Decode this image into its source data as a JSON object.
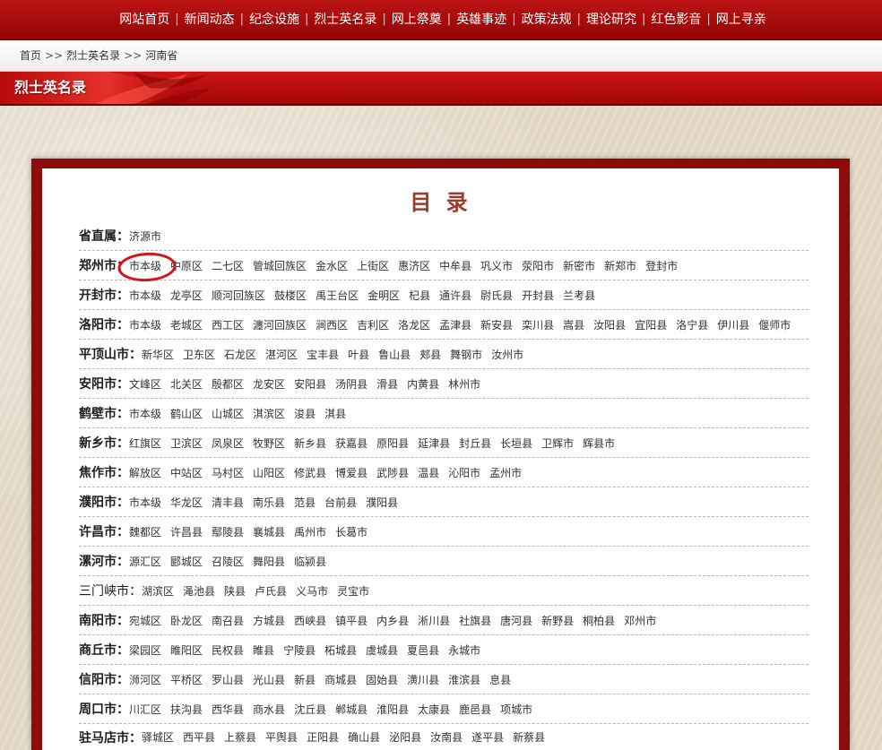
{
  "nav": {
    "separator": "|",
    "items": [
      "网站首页",
      "新闻动态",
      "纪念设施",
      "烈士英名录",
      "网上祭奠",
      "英雄事迹",
      "政策法规",
      "理论研究",
      "红色影音",
      "网上寻亲"
    ]
  },
  "breadcrumb": {
    "separator": ">>",
    "items": [
      "首页",
      "烈士英名录",
      "河南省"
    ]
  },
  "section": {
    "title": "烈士英名录"
  },
  "directory": {
    "title": "目 录",
    "rows": [
      {
        "label": "省直属：",
        "links": [
          "济源市"
        ]
      },
      {
        "label": "郑州市：",
        "links": [
          "市本级",
          "中原区",
          "二七区",
          "管城回族区",
          "金水区",
          "上街区",
          "惠济区",
          "中牟县",
          "巩义市",
          "荥阳市",
          "新密市",
          "新郑市",
          "登封市"
        ]
      },
      {
        "label": "开封市：",
        "links": [
          "市本级",
          "龙亭区",
          "顺河回族区",
          "鼓楼区",
          "禹王台区",
          "金明区",
          "杞县",
          "通许县",
          "尉氏县",
          "开封县",
          "兰考县"
        ]
      },
      {
        "label": "洛阳市：",
        "links": [
          "市本级",
          "老城区",
          "西工区",
          "瀍河回族区",
          "涧西区",
          "吉利区",
          "洛龙区",
          "孟津县",
          "新安县",
          "栾川县",
          "嵩县",
          "汝阳县",
          "宜阳县",
          "洛宁县",
          "伊川县",
          "偃师市"
        ]
      },
      {
        "label": "平顶山市：",
        "links": [
          "新华区",
          "卫东区",
          "石龙区",
          "湛河区",
          "宝丰县",
          "叶县",
          "鲁山县",
          "郏县",
          "舞钢市",
          "汝州市"
        ]
      },
      {
        "label": "安阳市：",
        "links": [
          "文峰区",
          "北关区",
          "殷都区",
          "龙安区",
          "安阳县",
          "汤阴县",
          "滑县",
          "内黄县",
          "林州市"
        ]
      },
      {
        "label": "鹤壁市：",
        "links": [
          "市本级",
          "鹤山区",
          "山城区",
          "淇滨区",
          "浚县",
          "淇县"
        ]
      },
      {
        "label": "新乡市：",
        "links": [
          "红旗区",
          "卫滨区",
          "凤泉区",
          "牧野区",
          "新乡县",
          "获嘉县",
          "原阳县",
          "延津县",
          "封丘县",
          "长垣县",
          "卫辉市",
          "辉县市"
        ]
      },
      {
        "label": "焦作市：",
        "links": [
          "解放区",
          "中站区",
          "马村区",
          "山阳区",
          "修武县",
          "博爱县",
          "武陟县",
          "温县",
          "沁阳市",
          "孟州市"
        ]
      },
      {
        "label": "濮阳市：",
        "links": [
          "市本级",
          "华龙区",
          "清丰县",
          "南乐县",
          "范县",
          "台前县",
          "濮阳县"
        ]
      },
      {
        "label": "许昌市：",
        "links": [
          "魏都区",
          "许昌县",
          "鄢陵县",
          "襄城县",
          "禹州市",
          "长葛市"
        ]
      },
      {
        "label": "漯河市：",
        "links": [
          "源汇区",
          "郾城区",
          "召陵区",
          "舞阳县",
          "临颍县"
        ]
      },
      {
        "label": "三门峡市：",
        "label_bold": false,
        "links": [
          "湖滨区",
          "渑池县",
          "陕县",
          "卢氏县",
          "义马市",
          "灵宝市"
        ]
      },
      {
        "label": "南阳市：",
        "links": [
          "宛城区",
          "卧龙区",
          "南召县",
          "方城县",
          "西峡县",
          "镇平县",
          "内乡县",
          "淅川县",
          "社旗县",
          "唐河县",
          "新野县",
          "桐柏县",
          "邓州市"
        ]
      },
      {
        "label": "商丘市：",
        "links": [
          "梁园区",
          "睢阳区",
          "民权县",
          "睢县",
          "宁陵县",
          "柘城县",
          "虞城县",
          "夏邑县",
          "永城市"
        ]
      },
      {
        "label": "信阳市：",
        "links": [
          "浉河区",
          "平桥区",
          "罗山县",
          "光山县",
          "新县",
          "商城县",
          "固始县",
          "潢川县",
          "淮滨县",
          "息县"
        ]
      },
      {
        "label": "周口市：",
        "links": [
          "川汇区",
          "扶沟县",
          "西华县",
          "商水县",
          "沈丘县",
          "郸城县",
          "淮阳县",
          "太康县",
          "鹿邑县",
          "项城市"
        ]
      },
      {
        "label": "驻马店市：",
        "links": [
          "驿城区",
          "西平县",
          "上蔡县",
          "平舆县",
          "正阳县",
          "确山县",
          "泌阳县",
          "汝南县",
          "遂平县",
          "新蔡县"
        ]
      }
    ]
  },
  "colors": {
    "nav_top": "#bd1414",
    "nav_bottom": "#930404",
    "title": "#9b3b2b",
    "frame": "#8e0b0b",
    "highlight": "#d4161c",
    "paper": "#e7dccb"
  }
}
